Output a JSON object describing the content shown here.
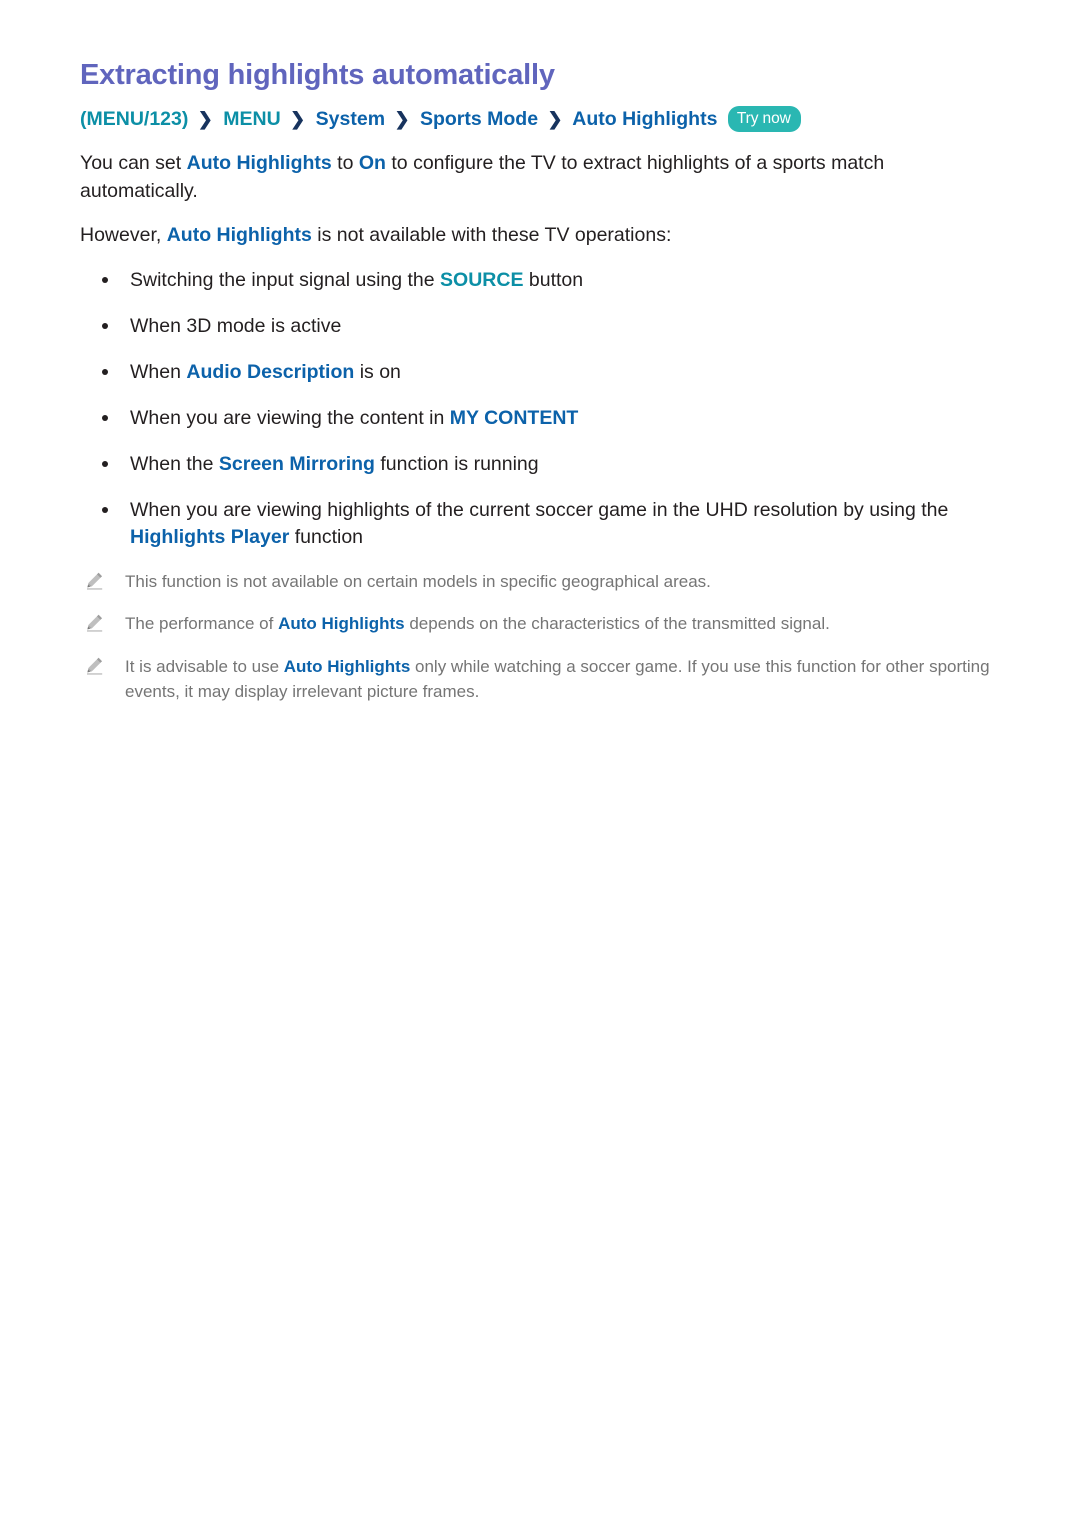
{
  "document": {
    "title": "Extracting highlights automatically",
    "breadcrumb": {
      "items": [
        {
          "label": "(MENU/123)",
          "style": "teal"
        },
        {
          "label": "MENU",
          "style": "teal"
        },
        {
          "label": "System",
          "style": "blue"
        },
        {
          "label": "Sports Mode",
          "style": "blue"
        },
        {
          "label": "Auto Highlights",
          "style": "blue"
        }
      ],
      "separator": "❯",
      "badge": "Try now"
    },
    "paragraphs": {
      "intro": {
        "part1": "You can set ",
        "key1": "Auto Highlights",
        "part2": " to ",
        "key2": "On",
        "part3": " to configure the TV to extract highlights of a sports match automatically."
      },
      "however": {
        "part1": "However, ",
        "key1": "Auto Highlights",
        "part2": " is not available with these TV operations:"
      }
    },
    "bullets": [
      {
        "part1": "Switching the input signal using the ",
        "key1": "SOURCE",
        "key1_style": "teal",
        "part2": " button"
      },
      {
        "part1": "When 3D mode is active",
        "key1": "",
        "key1_style": "blue",
        "part2": ""
      },
      {
        "part1": "When ",
        "key1": "Audio Description",
        "key1_style": "blue",
        "part2": " is on"
      },
      {
        "part1": "When you are viewing the content in ",
        "key1": "MY CONTENT",
        "key1_style": "blue",
        "part2": ""
      },
      {
        "part1": "When the ",
        "key1": "Screen Mirroring",
        "key1_style": "blue",
        "part2": " function is running"
      },
      {
        "part1": "When you are viewing highlights of the current soccer game in the UHD resolution by using the ",
        "key1": "Highlights Player",
        "key1_style": "blue",
        "part2": " function"
      }
    ],
    "notes": [
      {
        "icon": "pencil-icon",
        "part1": "This function is not available on certain models in specific geographical areas.",
        "key1": "",
        "part2": ""
      },
      {
        "icon": "pencil-icon",
        "part1": "The performance of ",
        "key1": "Auto Highlights",
        "part2": " depends on the characteristics of the transmitted signal."
      },
      {
        "icon": "pencil-icon",
        "part1": "It is advisable to use ",
        "key1": "Auto Highlights",
        "part2": " only while watching a soccer game. If you use this function for other sporting events, it may display irrelevant picture frames."
      }
    ],
    "colors": {
      "title": "#6065bd",
      "link_blue": "#0c62aa",
      "link_teal": "#0c8fa6",
      "badge_bg": "#2ab7b2",
      "body_text": "#231f20",
      "note_text": "#757575",
      "chevron": "#17335e"
    }
  }
}
